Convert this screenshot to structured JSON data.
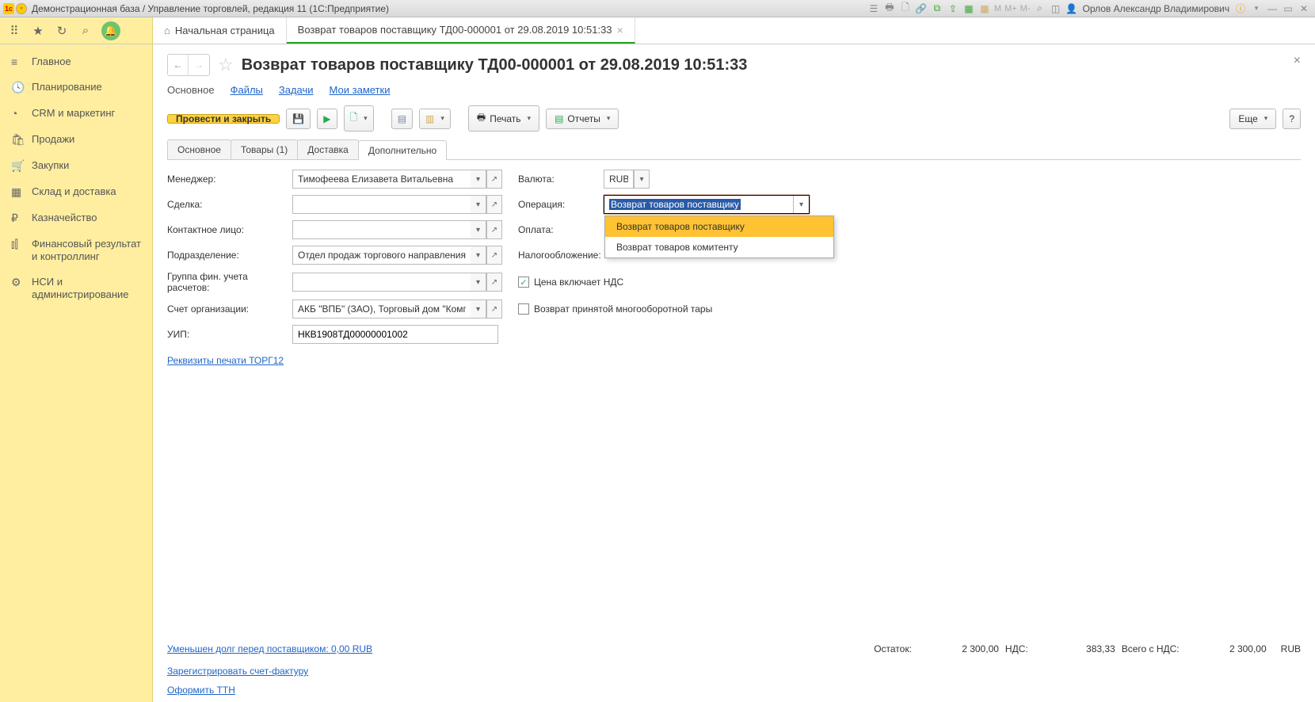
{
  "titlebar": {
    "app_title": "Демонстрационная база / Управление торговлей, редакция 11  (1С:Предприятие)",
    "user": "Орлов Александр Владимирович",
    "m_items": [
      "M",
      "M+",
      "M-"
    ]
  },
  "topbar": {
    "home_tab": "Начальная страница",
    "doc_tab": "Возврат товаров поставщику ТД00-000001 от 29.08.2019 10:51:33"
  },
  "sidebar": {
    "items": [
      "Главное",
      "Планирование",
      "CRM и маркетинг",
      "Продажи",
      "Закупки",
      "Склад и доставка",
      "Казначейство",
      "Финансовый результат и контроллинг",
      "НСИ и администрирование"
    ]
  },
  "doc": {
    "title": "Возврат товаров поставщику ТД00-000001 от 29.08.2019 10:51:33",
    "subtabs": [
      "Основное",
      "Файлы",
      "Задачи",
      "Мои заметки"
    ],
    "toolbar": {
      "post_close": "Провести и закрыть",
      "print": "Печать",
      "reports": "Отчеты",
      "more": "Еще"
    },
    "form_tabs": [
      "Основное",
      "Товары (1)",
      "Доставка",
      "Дополнительно"
    ],
    "fields": {
      "manager_label": "Менеджер:",
      "manager_value": "Тимофеева Елизавета Витальевна",
      "currency_label": "Валюта:",
      "currency_value": "RUB",
      "deal_label": "Сделка:",
      "deal_value": "",
      "operation_label": "Операция:",
      "operation_value": "Возврат товаров поставщику",
      "operation_options": [
        "Возврат товаров поставщику",
        "Возврат товаров комитенту"
      ],
      "contact_label": "Контактное лицо:",
      "contact_value": "",
      "payment_label": "Оплата:",
      "dept_label": "Подразделение:",
      "dept_value": "Отдел продаж торгового направления",
      "tax_label": "Налогообложение:",
      "fin_group_label": "Группа фин. учета расчетов:",
      "fin_group_value": "",
      "price_incl_vat": "Цена включает НДС",
      "return_tare": "Возврат принятой многооборотной тары",
      "account_label": "Счет организации:",
      "account_value": "АКБ \"ВПБ\" (ЗАО), Торговый дом \"Комп",
      "uip_label": "УИП:",
      "uip_value": "НКВ1908ТД00000001002",
      "torg12_link": "Реквизиты печати ТОРГ12"
    },
    "footer": {
      "debt_link": "Уменьшен долг перед поставщиком: 0,00 RUB",
      "balance_label": "Остаток:",
      "balance_value": "2 300,00",
      "vat_label": "НДС:",
      "vat_value": "383,33",
      "total_label": "Всего с НДС:",
      "total_value": "2 300,00",
      "currency": "RUB",
      "invoice_link": "Зарегистрировать счет-фактуру",
      "ttn_link": "Оформить ТТН"
    }
  }
}
